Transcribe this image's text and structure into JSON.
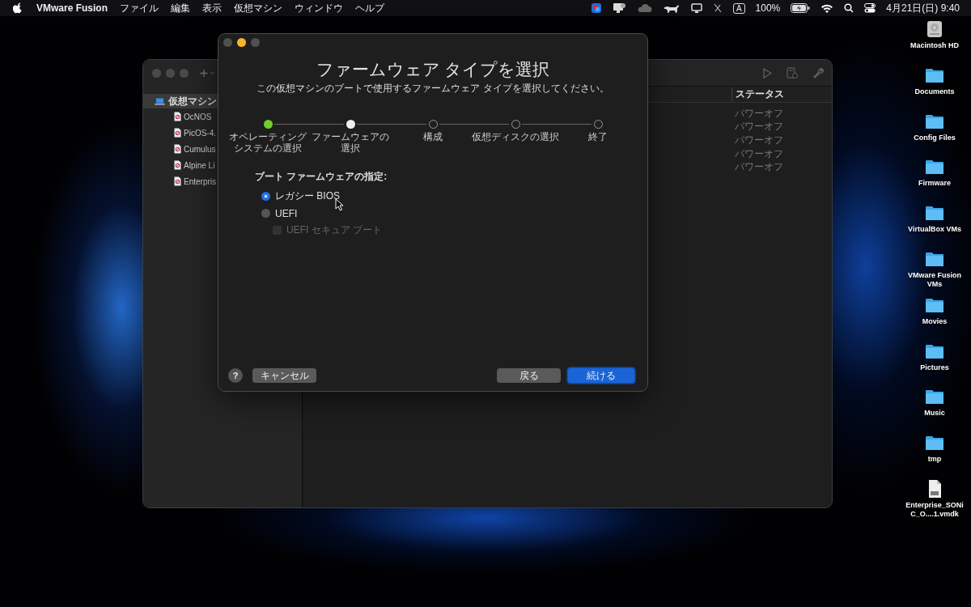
{
  "menubar": {
    "app": "VMware Fusion",
    "menus": [
      "ファイル",
      "編集",
      "表示",
      "仮想マシン",
      "ウィンドウ",
      "ヘルプ"
    ],
    "input_mode": "A",
    "battery": "100%",
    "clock": "4月21日(日) 9:40"
  },
  "library_window": {
    "sidebar": {
      "group": {
        "label": "仮想マシン",
        "selected": true
      },
      "items": [
        {
          "label": "OcNOS",
          "selected": false
        },
        {
          "label": "PicOS-4.",
          "selected": false
        },
        {
          "label": "Cumulus",
          "selected": false
        },
        {
          "label": "Alpine Li",
          "selected": false
        },
        {
          "label": "Enterpris",
          "selected": false
        }
      ]
    },
    "columns": [
      "ステータス"
    ],
    "rows": [
      {
        "status": "パワーオフ"
      },
      {
        "status": "パワーオフ"
      },
      {
        "status": "パワーオフ"
      },
      {
        "status": "パワーオフ"
      },
      {
        "status": "パワーオフ"
      }
    ]
  },
  "dialog": {
    "title": "ファームウェア タイプを選択",
    "subtitle": "この仮想マシンのブートで使用するファームウェア タイプを選択してください。",
    "steps": [
      {
        "label_lines": [
          "オペレーティング",
          "システムの選択"
        ],
        "completed": true,
        "current": false
      },
      {
        "label_lines": [
          "ファームウェアの",
          "選択"
        ],
        "completed": false,
        "current": true
      },
      {
        "label_lines": [
          "構成"
        ],
        "completed": false,
        "current": false
      },
      {
        "label_lines": [
          "仮想ディスクの選択"
        ],
        "completed": false,
        "current": false
      },
      {
        "label_lines": [
          "終了"
        ],
        "completed": false,
        "current": false
      }
    ],
    "section_label": "ブート ファームウェアの指定:",
    "options": [
      {
        "kind": "radio",
        "label": "レガシー BIOS",
        "selected": true,
        "disabled": false
      },
      {
        "kind": "radio",
        "label": "UEFI",
        "selected": false,
        "disabled": false
      },
      {
        "kind": "checkbox",
        "label": "UEFI セキュア ブート",
        "checked": false,
        "disabled": true
      }
    ],
    "help": "?",
    "buttons": [
      {
        "label": "キャンセル",
        "kind": "secondary"
      },
      {
        "label": "戻る",
        "kind": "secondary"
      },
      {
        "label": "続ける",
        "kind": "primary"
      }
    ]
  },
  "desktop_icons": [
    {
      "label": "Macintosh HD",
      "kind": "disk"
    },
    {
      "label": "Documents",
      "kind": "folder"
    },
    {
      "label": "Config Files",
      "kind": "folder"
    },
    {
      "label": "Firmware",
      "kind": "folder"
    },
    {
      "label": "VirtualBox VMs",
      "kind": "folder"
    },
    {
      "label": "VMware Fusion VMs",
      "kind": "folder"
    },
    {
      "label": "Movies",
      "kind": "folder"
    },
    {
      "label": "Pictures",
      "kind": "folder"
    },
    {
      "label": "Music",
      "kind": "folder"
    },
    {
      "label": "tmp",
      "kind": "folder"
    },
    {
      "label": "Enterprise_SONiC_O....1.vmdk",
      "kind": "file"
    }
  ]
}
